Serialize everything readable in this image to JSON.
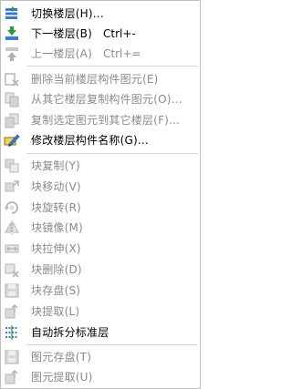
{
  "menu": {
    "items": [
      {
        "label": "切换楼层(H)...",
        "shortcut": "",
        "icon": "floor-switch-icon",
        "enabled": true
      },
      {
        "label": "下一楼层(B)",
        "shortcut": "Ctrl+-",
        "icon": "next-floor-icon",
        "enabled": true
      },
      {
        "label": "上一楼层(A)",
        "shortcut": "Ctrl+=",
        "icon": "prev-floor-icon",
        "enabled": false
      },
      {
        "label": "删除当前楼层构件图元(E)",
        "shortcut": "",
        "icon": "delete-floor-components-icon",
        "enabled": false
      },
      {
        "label": "从其它楼层复制构件图元(O)...",
        "shortcut": "",
        "icon": "copy-from-floor-icon",
        "enabled": false
      },
      {
        "label": "复制选定图元到其它楼层(F)...",
        "shortcut": "",
        "icon": "copy-to-floor-icon",
        "enabled": false
      },
      {
        "label": "修改楼层构件名称(G)...",
        "shortcut": "",
        "icon": "rename-components-icon",
        "enabled": true
      },
      {
        "label": "块复制(Y)",
        "shortcut": "",
        "icon": "block-copy-icon",
        "enabled": false
      },
      {
        "label": "块移动(V)",
        "shortcut": "",
        "icon": "block-move-icon",
        "enabled": false
      },
      {
        "label": "块旋转(R)",
        "shortcut": "",
        "icon": "block-rotate-icon",
        "enabled": false
      },
      {
        "label": "块镜像(M)",
        "shortcut": "",
        "icon": "block-mirror-icon",
        "enabled": false
      },
      {
        "label": "块拉伸(X)",
        "shortcut": "",
        "icon": "block-stretch-icon",
        "enabled": false
      },
      {
        "label": "块删除(D)",
        "shortcut": "",
        "icon": "block-delete-icon",
        "enabled": false
      },
      {
        "label": "块存盘(S)",
        "shortcut": "",
        "icon": "block-save-icon",
        "enabled": false
      },
      {
        "label": "块提取(L)",
        "shortcut": "",
        "icon": "block-extract-icon",
        "enabled": false
      },
      {
        "label": "自动拆分标准层",
        "shortcut": "",
        "icon": "auto-split-floor-icon",
        "enabled": true
      },
      {
        "label": "图元存盘(T)",
        "shortcut": "",
        "icon": "element-save-icon",
        "enabled": false
      },
      {
        "label": "图元提取(U)",
        "shortcut": "",
        "icon": "element-extract-icon",
        "enabled": false
      }
    ]
  }
}
